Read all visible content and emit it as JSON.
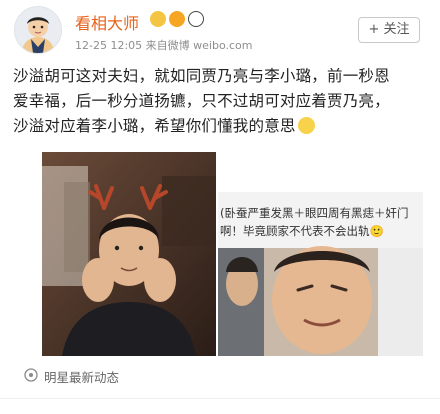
{
  "header": {
    "user_name": "看相大师",
    "meta": "12-25 12:05  来自微博 weibo.com",
    "follow_label": "+ 关注"
  },
  "post": {
    "lines": [
      "沙溢胡可这对夫妇，就如同贾乃亮与李小璐，前一秒恩",
      "爱幸福，后一秒分道扬镳，只不过胡可对应着贾乃亮，",
      "沙溢对应着李小璐，希望你们懂我的意思"
    ]
  },
  "side_image": {
    "lines": [
      "(卧蚕严重发黑＋眼四周有黑痣＋奸门",
      "啊！毕竟顾家不代表不会出轨🙂"
    ]
  },
  "topic": {
    "label": "明星最新动态"
  },
  "colors": {
    "name": "#e8621a",
    "text": "#222222",
    "meta": "#8e8e8e"
  }
}
